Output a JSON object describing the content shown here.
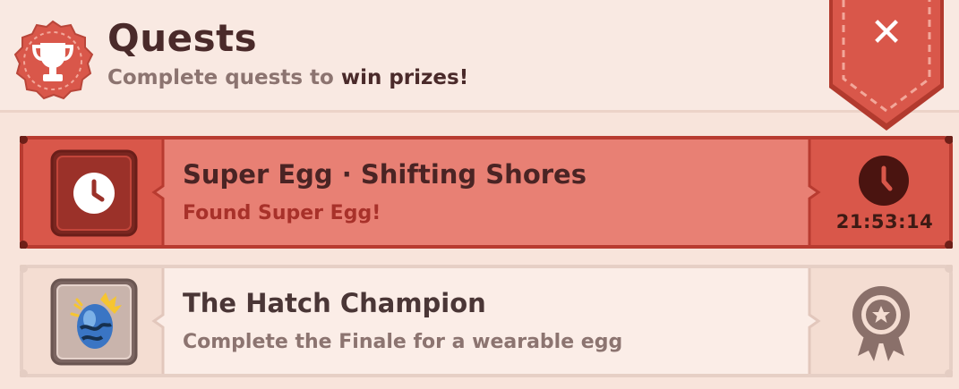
{
  "header": {
    "title": "Quests",
    "subtitle_prefix": "Complete quests to ",
    "subtitle_emphasis": "win prizes!",
    "badge_icon": "trophy-icon",
    "close_icon": "close-icon"
  },
  "quests": [
    {
      "title": "Super Egg · Shifting Shores",
      "subtitle": "Found Super Egg!",
      "icon": "clock-icon",
      "status_icon": "clock-icon",
      "timer": "21:53:14",
      "state": "active"
    },
    {
      "title": "The Hatch Champion",
      "subtitle": "Complete the Finale for a wearable egg",
      "icon": "egg-icon",
      "status_icon": "award-ribbon-icon",
      "state": "locked"
    }
  ],
  "colors": {
    "accent": "#d9574a",
    "accent_dark": "#b23a2e",
    "background": "#f8e4db",
    "text_dark": "#4a2a2a",
    "text_muted": "#8c7470"
  }
}
